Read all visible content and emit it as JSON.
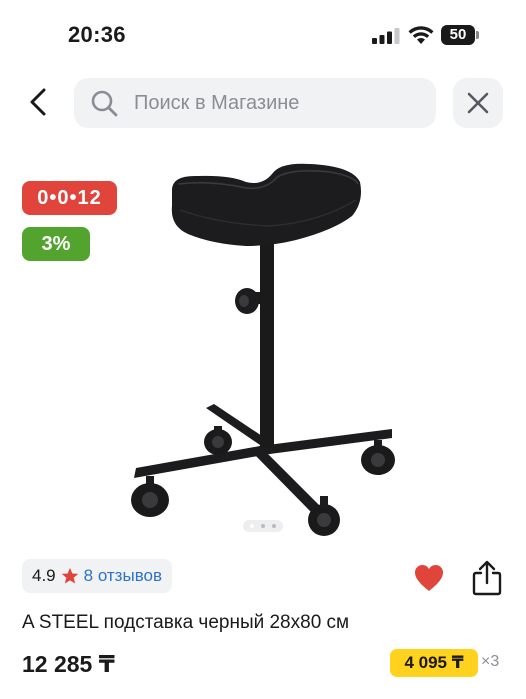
{
  "status_bar": {
    "time": "20:36",
    "battery": "50"
  },
  "search": {
    "placeholder": "Поиск в Магазине"
  },
  "icons": {
    "back": "chevron-left-icon",
    "search": "search-icon",
    "close": "close-icon",
    "favorite": "heart-icon",
    "share": "share-icon",
    "rating": "star-icon"
  },
  "badges": {
    "installment": "0•0•12",
    "bonus": "3% Б"
  },
  "gallery": {
    "image_count": 3,
    "active_index": 0
  },
  "rating": {
    "value": "4.9",
    "reviews": "8 отзывов"
  },
  "product": {
    "title": "A STEEL подставка черный 28х80 см",
    "price": "12 285 ₸",
    "installment_price": "4 095 ₸",
    "installment_multiplier": "×3"
  },
  "colors": {
    "installment_badge": "#e0443a",
    "bonus_badge": "#52a42f",
    "installment_price_bg": "#ffd21e",
    "link": "#2e73c8",
    "favorite": "#e0443a"
  }
}
